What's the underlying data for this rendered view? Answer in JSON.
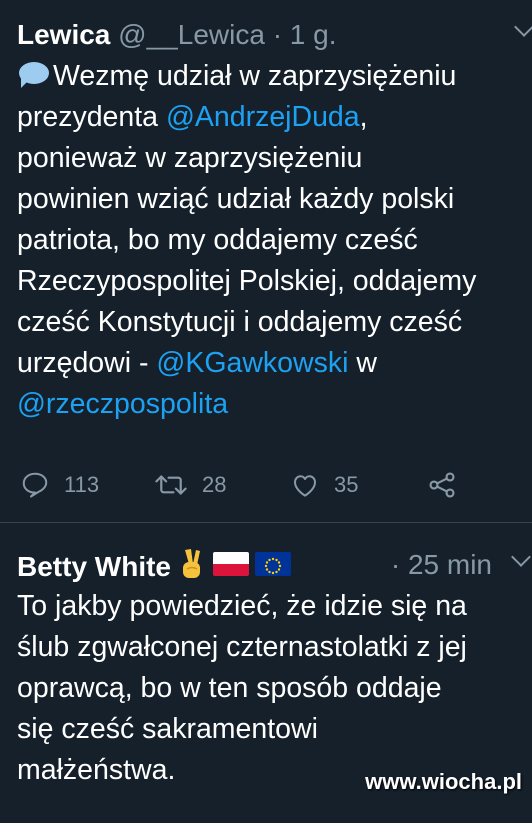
{
  "tweets": [
    {
      "author_name": "Lewica",
      "author_handle": "@__Lewica",
      "separator": "·",
      "time": "1 g.",
      "emoji": "speech-balloon",
      "lines": [
        {
          "segments": [
            {
              "text": "Wezmę udział w zaprzysiężeniu",
              "type": "text"
            }
          ]
        },
        {
          "segments": [
            {
              "text": "prezydenta ",
              "type": "text"
            },
            {
              "text": "@AndrzejDuda",
              "type": "mention"
            },
            {
              "text": ",",
              "type": "text"
            }
          ]
        },
        {
          "segments": [
            {
              "text": "ponieważ w zaprzysiężeniu",
              "type": "text"
            }
          ]
        },
        {
          "segments": [
            {
              "text": "powinien wziąć udział każdy polski",
              "type": "text"
            }
          ]
        },
        {
          "segments": [
            {
              "text": "patriota, bo my oddajemy cześć",
              "type": "text"
            }
          ]
        },
        {
          "segments": [
            {
              "text": "Rzeczypospolitej Polskiej, oddajemy",
              "type": "text"
            }
          ]
        },
        {
          "segments": [
            {
              "text": "cześć Konstytucji i oddajemy cześć",
              "type": "text"
            }
          ]
        },
        {
          "segments": [
            {
              "text": "urzędowi - ",
              "type": "text"
            },
            {
              "text": "@KGawkowski",
              "type": "mention"
            },
            {
              "text": " w",
              "type": "text"
            }
          ]
        },
        {
          "segments": [
            {
              "text": "@rzeczpospolita",
              "type": "mention"
            }
          ]
        }
      ],
      "actions": {
        "replies": "113",
        "retweets": "28",
        "likes": "35"
      }
    },
    {
      "author_name": "Betty White",
      "author_handle": "",
      "separator": "·",
      "time": "25 min",
      "emojis": [
        "victory-hand",
        "flag-poland",
        "flag-eu"
      ],
      "lines": [
        {
          "segments": [
            {
              "text": "To jakby powiedzieć, że idzie się na",
              "type": "text"
            }
          ]
        },
        {
          "segments": [
            {
              "text": "ślub zgwałconej czternastolatki z jej",
              "type": "text"
            }
          ]
        },
        {
          "segments": [
            {
              "text": "oprawcą, bo w ten sposób oddaje",
              "type": "text"
            }
          ]
        },
        {
          "segments": [
            {
              "text": "się cześć sakramentowi",
              "type": "text"
            }
          ]
        },
        {
          "segments": [
            {
              "text": "małżeństwa.",
              "type": "text"
            }
          ]
        }
      ]
    }
  ],
  "watermark": "www.wiocha.pl",
  "colors": {
    "background": "#15202b",
    "text": "#ffffff",
    "muted": "#8899a6",
    "link": "#1da1f2",
    "divider": "#38444d"
  }
}
